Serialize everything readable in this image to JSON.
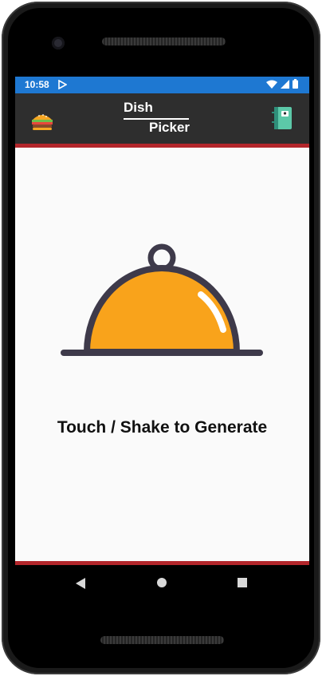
{
  "status_bar": {
    "time": "10:58"
  },
  "app_bar": {
    "title_line1": "Dish",
    "title_line2": "Picker",
    "left_icon": "burger-icon",
    "right_icon": "notebook-icon"
  },
  "main": {
    "illustration": "cloche-icon",
    "prompt": "Touch / Shake to Generate"
  },
  "colors": {
    "status_bar": "#1e78d2",
    "app_bar": "#2e2e2e",
    "accent_red": "#b3262b",
    "cloche_orange": "#f9a31b",
    "cloche_outline": "#3e3a4a"
  }
}
